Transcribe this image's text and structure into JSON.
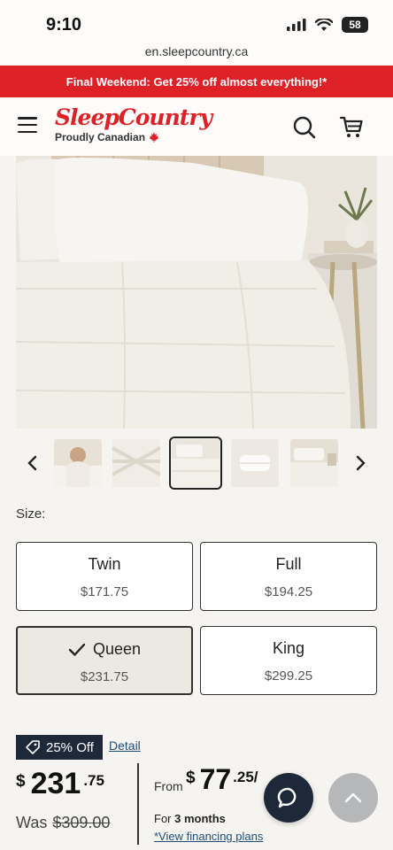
{
  "status_bar": {
    "time": "9:10",
    "battery": "58"
  },
  "browser": {
    "url": "en.sleepcountry.ca"
  },
  "promo": {
    "text": "Final Weekend: Get 25% off almost everything!*"
  },
  "header": {
    "logo": "SleepCountry",
    "tagline": "Proudly Canadian",
    "icons": [
      "menu-icon",
      "search-icon",
      "cart-icon"
    ]
  },
  "gallery": {
    "icons": [
      "chevron-left-icon",
      "chevron-right-icon"
    ],
    "thumbnail_count": 5,
    "active_thumbnail": 3
  },
  "size": {
    "label": "Size:",
    "options": [
      {
        "name": "Twin",
        "price": "$171.75",
        "selected": false
      },
      {
        "name": "Full",
        "price": "$194.25",
        "selected": false
      },
      {
        "name": "Queen",
        "price": "$231.75",
        "selected": true
      },
      {
        "name": "King",
        "price": "$299.25",
        "selected": false
      }
    ]
  },
  "pricing": {
    "discount_badge": "25% Off",
    "detail_link": "Detail",
    "currency": "$",
    "dollars": "231",
    "cents": ".75",
    "was_label": "Was",
    "was_price": "$309.00"
  },
  "financing": {
    "from_label": "From",
    "currency": "$",
    "dollars": "77",
    "cents": ".25/",
    "term_prefix": "For",
    "term": "3 months",
    "link": "*View financing plans"
  },
  "colors": {
    "brand_red": "#de2127",
    "navy": "#1d2939",
    "link_blue": "#1e4d7a",
    "background": "#f6f4f0"
  }
}
